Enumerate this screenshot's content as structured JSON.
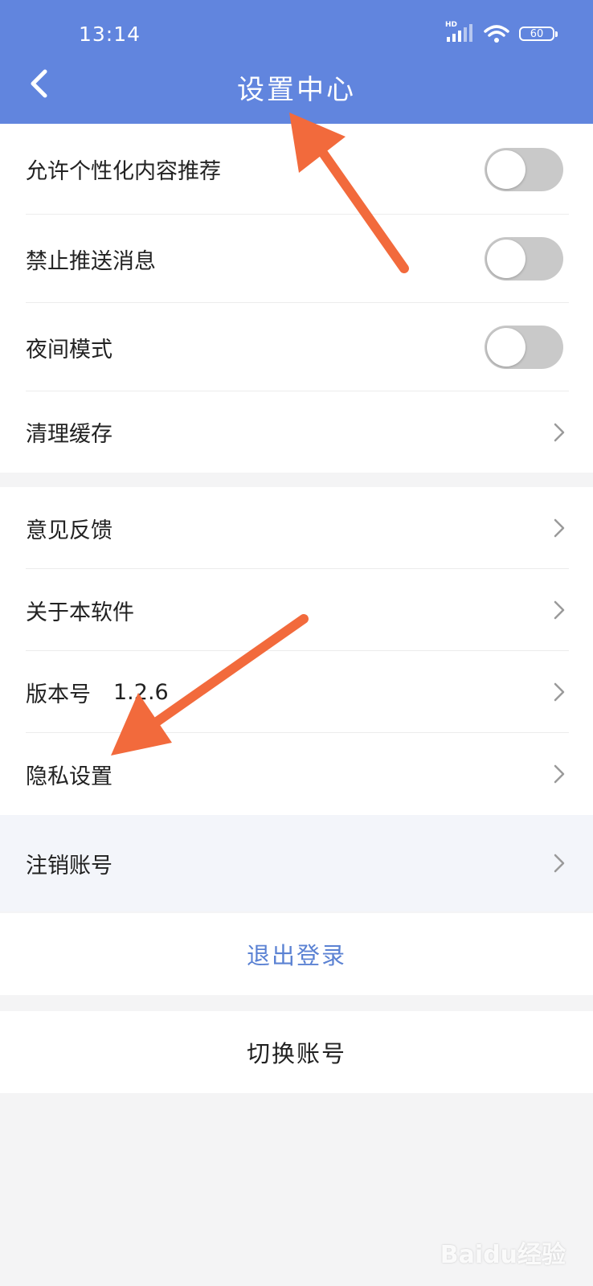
{
  "status_bar": {
    "time": "13:14",
    "network": "HD",
    "battery": "60",
    "icons": [
      "signal-icon",
      "wifi-icon",
      "battery-icon"
    ]
  },
  "header": {
    "title": "设置中心",
    "back_icon": "chevron-left-icon"
  },
  "group1": {
    "items": [
      {
        "label": "允许个性化内容推荐",
        "control": "toggle",
        "on": false
      },
      {
        "label": "禁止推送消息",
        "control": "toggle",
        "on": false
      },
      {
        "label": "夜间模式",
        "control": "toggle",
        "on": false
      },
      {
        "label": "清理缓存",
        "control": "chevron"
      }
    ]
  },
  "group2": {
    "items": [
      {
        "label": "意见反馈",
        "control": "chevron"
      },
      {
        "label": "关于本软件",
        "control": "chevron"
      },
      {
        "label": "版本号",
        "value": "1.2.6",
        "control": "chevron"
      },
      {
        "label": "隐私设置",
        "control": "chevron"
      },
      {
        "label": "注销账号",
        "control": "chevron"
      }
    ]
  },
  "actions": {
    "logout_label": "退出登录",
    "switch_account_label": "切换账号"
  },
  "watermark": {
    "text": "Baidu经验"
  },
  "colors": {
    "header_bg": "#6185de",
    "page_bg": "#f4f4f5",
    "logout_text": "#5b82d3",
    "toggle_off": "#c9c9c9",
    "annotation_arrow": "#f26a3c",
    "highlight_row": "#f3f5fa"
  }
}
